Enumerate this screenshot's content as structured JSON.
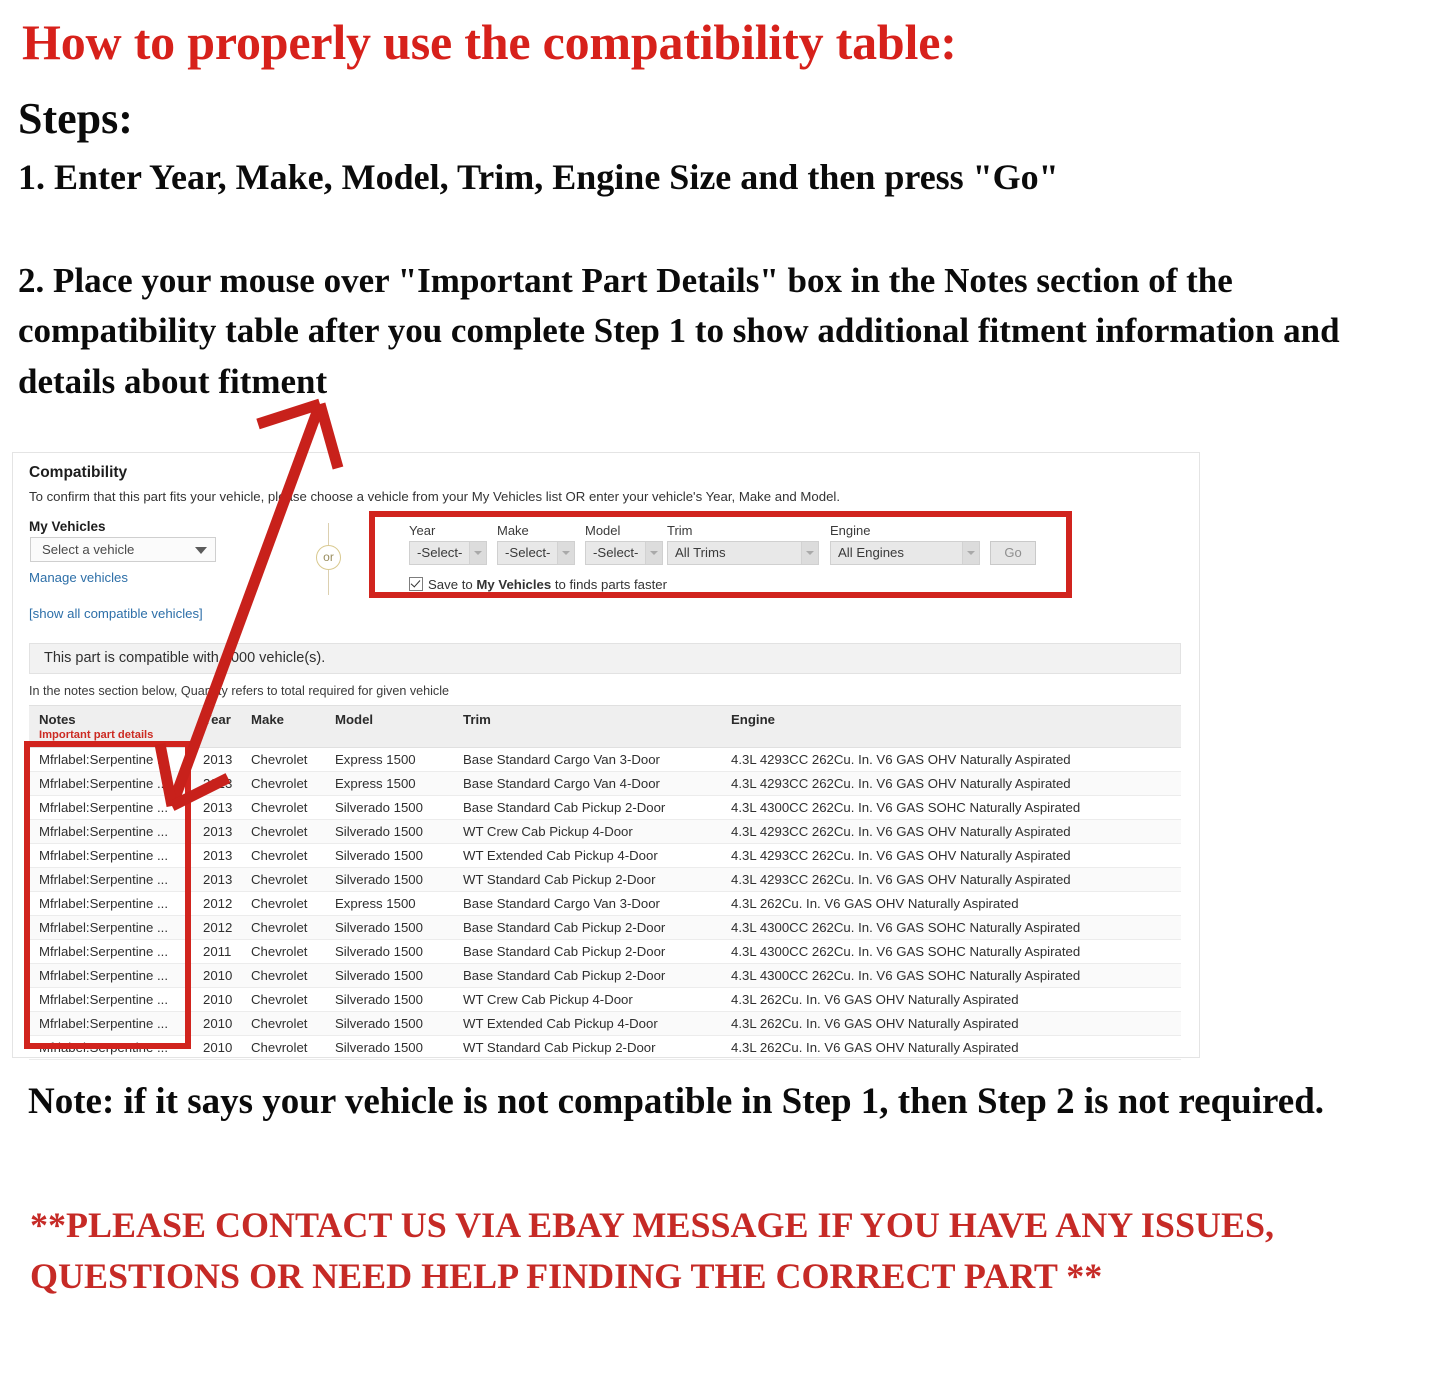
{
  "headings": {
    "title": "How to properly use the compatibility table:",
    "steps_label": "Steps:",
    "step_1": "1. Enter Year, Make, Model, Trim, Engine Size and then press \"Go\"",
    "step_2": "2. Place your mouse over \"Important Part Details\" box in the Notes section of the compatibility table after you complete Step 1 to show additional fitment information and details about fitment",
    "note": "Note: if it says your vehicle is not compatible in Step 1, then Step 2 is not required.",
    "contact": "**PLEASE CONTACT US VIA EBAY MESSAGE IF YOU HAVE ANY ISSUES, QUESTIONS OR NEED HELP FINDING THE CORRECT PART **"
  },
  "widget": {
    "title": "Compatibility",
    "subtitle": "To confirm that this part fits your vehicle, please choose a vehicle from your My Vehicles list OR enter your vehicle's Year, Make and Model.",
    "my_vehicles": {
      "label": "My Vehicles",
      "select_value": "Select a vehicle",
      "manage_link": "Manage vehicles",
      "show_all_link": "[show all compatible vehicles]"
    },
    "or_divider": "or",
    "form": {
      "fields": [
        {
          "label": "Year",
          "value": "-Select-"
        },
        {
          "label": "Make",
          "value": "-Select-"
        },
        {
          "label": "Model",
          "value": "-Select-"
        },
        {
          "label": "Trim",
          "value": "All Trims"
        },
        {
          "label": "Engine",
          "value": "All Engines"
        }
      ],
      "go_label": "Go",
      "save_checkbox": {
        "checked": true,
        "prefix": "Save to ",
        "bold": "My Vehicles",
        "suffix": " to finds parts faster"
      }
    },
    "compat_banner": "This part is compatible with 1000 vehicle(s).",
    "qty_note": "In the notes section below, Quantity refers to total required for given vehicle",
    "table": {
      "headers": [
        "Notes",
        "Year",
        "Make",
        "Model",
        "Trim",
        "Engine"
      ],
      "notes_subheader": "Important part details",
      "rows": [
        [
          "Mfrlabel:Serpentine ...",
          "2013",
          "Chevrolet",
          "Express 1500",
          "Base Standard Cargo Van 3-Door",
          "4.3L 4293CC 262Cu. In. V6 GAS OHV Naturally Aspirated"
        ],
        [
          "Mfrlabel:Serpentine ...",
          "2013",
          "Chevrolet",
          "Express 1500",
          "Base Standard Cargo Van 4-Door",
          "4.3L 4293CC 262Cu. In. V6 GAS OHV Naturally Aspirated"
        ],
        [
          "Mfrlabel:Serpentine ...",
          "2013",
          "Chevrolet",
          "Silverado 1500",
          "Base Standard Cab Pickup 2-Door",
          "4.3L 4300CC 262Cu. In. V6 GAS SOHC Naturally Aspirated"
        ],
        [
          "Mfrlabel:Serpentine ...",
          "2013",
          "Chevrolet",
          "Silverado 1500",
          "WT Crew Cab Pickup 4-Door",
          "4.3L 4293CC 262Cu. In. V6 GAS OHV Naturally Aspirated"
        ],
        [
          "Mfrlabel:Serpentine ...",
          "2013",
          "Chevrolet",
          "Silverado 1500",
          "WT Extended Cab Pickup 4-Door",
          "4.3L 4293CC 262Cu. In. V6 GAS OHV Naturally Aspirated"
        ],
        [
          "Mfrlabel:Serpentine ...",
          "2013",
          "Chevrolet",
          "Silverado 1500",
          "WT Standard Cab Pickup 2-Door",
          "4.3L 4293CC 262Cu. In. V6 GAS OHV Naturally Aspirated"
        ],
        [
          "Mfrlabel:Serpentine ...",
          "2012",
          "Chevrolet",
          "Express 1500",
          "Base Standard Cargo Van 3-Door",
          "4.3L 262Cu. In. V6 GAS OHV Naturally Aspirated"
        ],
        [
          "Mfrlabel:Serpentine ...",
          "2012",
          "Chevrolet",
          "Silverado 1500",
          "Base Standard Cab Pickup 2-Door",
          "4.3L 4300CC 262Cu. In. V6 GAS SOHC Naturally Aspirated"
        ],
        [
          "Mfrlabel:Serpentine ...",
          "2011",
          "Chevrolet",
          "Silverado 1500",
          "Base Standard Cab Pickup 2-Door",
          "4.3L 4300CC 262Cu. In. V6 GAS SOHC Naturally Aspirated"
        ],
        [
          "Mfrlabel:Serpentine ...",
          "2010",
          "Chevrolet",
          "Silverado 1500",
          "Base Standard Cab Pickup 2-Door",
          "4.3L 4300CC 262Cu. In. V6 GAS SOHC Naturally Aspirated"
        ],
        [
          "Mfrlabel:Serpentine ...",
          "2010",
          "Chevrolet",
          "Silverado 1500",
          "WT Crew Cab Pickup 4-Door",
          "4.3L 262Cu. In. V6 GAS OHV Naturally Aspirated"
        ],
        [
          "Mfrlabel:Serpentine ...",
          "2010",
          "Chevrolet",
          "Silverado 1500",
          "WT Extended Cab Pickup 4-Door",
          "4.3L 262Cu. In. V6 GAS OHV Naturally Aspirated"
        ],
        [
          "Mfrlabel:Serpentine ...",
          "2010",
          "Chevrolet",
          "Silverado 1500",
          "WT Standard Cab Pickup 2-Door",
          "4.3L 262Cu. In. V6 GAS OHV Naturally Aspirated"
        ]
      ]
    }
  },
  "colors": {
    "heading_red": "#D7211B",
    "callout_red": "#D1241E",
    "link_blue": "#2d6fa8",
    "contact_red": "#C62A26"
  }
}
